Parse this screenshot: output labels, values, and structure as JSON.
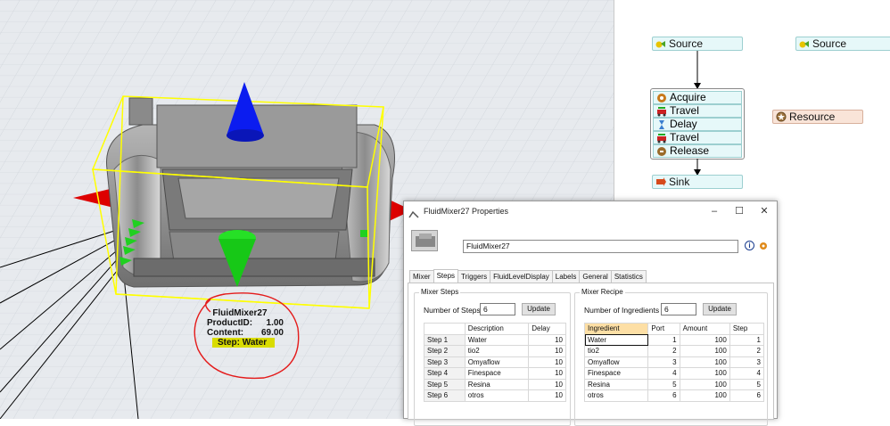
{
  "scene": {
    "object_label": {
      "name": "FluidMixer27",
      "product_id_label": "ProductID:",
      "product_id_value": "1.00",
      "content_label": "Content:",
      "content_value": "69.00",
      "step_text": "Step:  Water"
    },
    "colors": {
      "grid_bg": "#e7eaee",
      "bbox": "#ffff00",
      "arrow_blue": "#0000ff",
      "arrow_green": "#00cc00",
      "arrow_red": "#dd0000",
      "annotation": "#e41b1b"
    }
  },
  "process_flow": {
    "source_1": "Source",
    "source_2": "Source",
    "group": [
      "Acquire",
      "Travel",
      "Delay",
      "Travel",
      "Release"
    ],
    "sink": "Sink",
    "resource": "Resource"
  },
  "dialog": {
    "title": "FluidMixer27  Properties",
    "name_value": "FluidMixer27",
    "info_icon": "info-icon",
    "tabs": [
      "Mixer",
      "Steps",
      "Triggers",
      "FluidLevelDisplay",
      "Labels",
      "General",
      "Statistics"
    ],
    "active_tab": "Steps",
    "mixer_steps": {
      "legend": "Mixer Steps",
      "count_label": "Number of Steps",
      "count_value": "6",
      "update_label": "Update",
      "headers": [
        "",
        "Description",
        "Delay"
      ],
      "rows": [
        [
          "Step 1",
          "Water",
          "10"
        ],
        [
          "Step 2",
          "tio2",
          "10"
        ],
        [
          "Step 3",
          "Omyaflow",
          "10"
        ],
        [
          "Step 4",
          "Finespace",
          "10"
        ],
        [
          "Step 5",
          "Resina",
          "10"
        ],
        [
          "Step 6",
          "otros",
          "10"
        ]
      ]
    },
    "mixer_recipe": {
      "legend": "Mixer Recipe",
      "count_label": "Number of Ingredients",
      "count_value": "6",
      "update_label": "Update",
      "headers": [
        "Ingredient",
        "Port",
        "Amount",
        "Step"
      ],
      "rows": [
        [
          "Water",
          "1",
          "100",
          "1"
        ],
        [
          "tio2",
          "2",
          "100",
          "2"
        ],
        [
          "Omyaflow",
          "3",
          "100",
          "3"
        ],
        [
          "Finespace",
          "4",
          "100",
          "4"
        ],
        [
          "Resina",
          "5",
          "100",
          "5"
        ],
        [
          "otros",
          "6",
          "100",
          "6"
        ]
      ]
    }
  }
}
